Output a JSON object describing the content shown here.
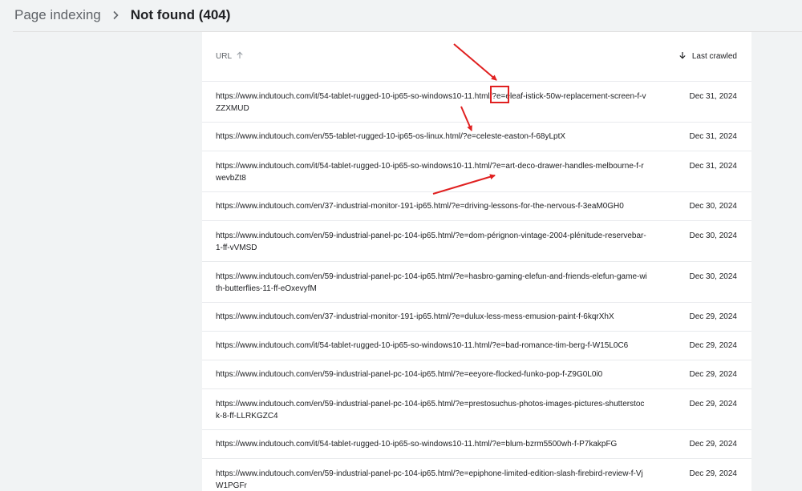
{
  "breadcrumb": {
    "root": "Page indexing",
    "current": "Not found (404)"
  },
  "table": {
    "columns": {
      "url": "URL",
      "last_crawled": "Last crawled"
    },
    "rows": [
      {
        "url": "https://www.indutouch.com/it/54-tablet-rugged-10-ip65-so-windows10-11.html/?e=eleaf-istick-50w-replacement-screen-f-vZZXMUD",
        "date": "Dec 31, 2024"
      },
      {
        "url": "https://www.indutouch.com/en/55-tablet-rugged-10-ip65-os-linux.html/?e=celeste-easton-f-68yLptX",
        "date": "Dec 31, 2024"
      },
      {
        "url": "https://www.indutouch.com/it/54-tablet-rugged-10-ip65-so-windows10-11.html/?e=art-deco-drawer-handles-melbourne-f-rwevbZt8",
        "date": "Dec 31, 2024"
      },
      {
        "url": "https://www.indutouch.com/en/37-industrial-monitor-191-ip65.html/?e=driving-lessons-for-the-nervous-f-3eaM0GH0",
        "date": "Dec 30, 2024"
      },
      {
        "url": "https://www.indutouch.com/en/59-industrial-panel-pc-104-ip65.html/?e=dom-pérignon-vintage-2004-plénitude-reservebar-1-ff-vVMSD",
        "date": "Dec 30, 2024"
      },
      {
        "url": "https://www.indutouch.com/en/59-industrial-panel-pc-104-ip65.html/?e=hasbro-gaming-elefun-and-friends-elefun-game-with-butterflies-11-ff-eOxevyfM",
        "date": "Dec 30, 2024"
      },
      {
        "url": "https://www.indutouch.com/en/37-industrial-monitor-191-ip65.html/?e=dulux-less-mess-emusion-paint-f-6kqrXhX",
        "date": "Dec 29, 2024"
      },
      {
        "url": "https://www.indutouch.com/it/54-tablet-rugged-10-ip65-so-windows10-11.html/?e=bad-romance-tim-berg-f-W15L0C6",
        "date": "Dec 29, 2024"
      },
      {
        "url": "https://www.indutouch.com/en/59-industrial-panel-pc-104-ip65.html/?e=eeyore-flocked-funko-pop-f-Z9G0L0i0",
        "date": "Dec 29, 2024"
      },
      {
        "url": "https://www.indutouch.com/en/59-industrial-panel-pc-104-ip65.html/?e=prestosuchus-photos-images-pictures-shutterstock-8-ff-LLRKGZC4",
        "date": "Dec 29, 2024"
      },
      {
        "url": "https://www.indutouch.com/it/54-tablet-rugged-10-ip65-so-windows10-11.html/?e=blum-bzrm5500wh-f-P7kakpFG",
        "date": "Dec 29, 2024"
      },
      {
        "url": "https://www.indutouch.com/en/59-industrial-panel-pc-104-ip65.html/?e=epiphone-limited-edition-slash-firebird-review-f-VjW1PGFr",
        "date": "Dec 29, 2024"
      }
    ]
  },
  "annotation_color": "#e02020",
  "icons": [
    "chevron-right-icon",
    "sort-up-arrow-icon",
    "sort-down-arrow-icon"
  ]
}
